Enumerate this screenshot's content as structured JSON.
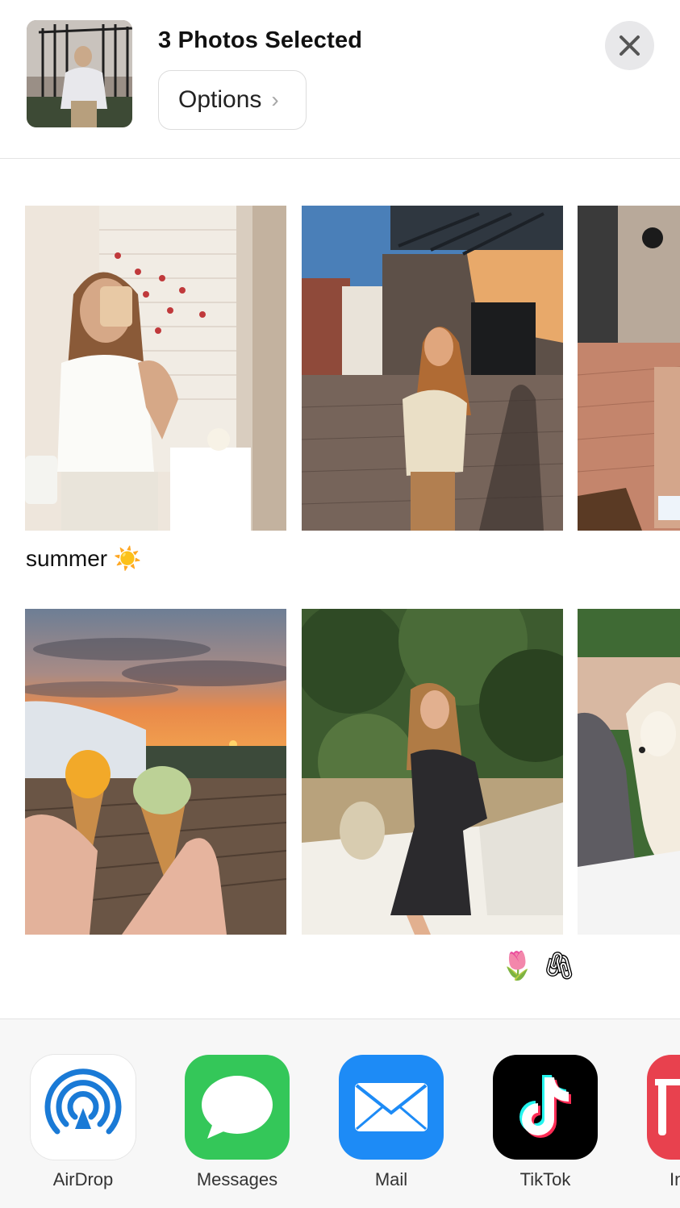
{
  "header": {
    "title": "3 Photos Selected",
    "options_label": "Options",
    "options_chevron": "›"
  },
  "gallery": {
    "posts": [
      {
        "caption": "summer ☀️"
      },
      {
        "caption": "🌷 🖇"
      }
    ]
  },
  "share_apps": [
    {
      "label": "AirDrop",
      "icon": "airdrop-icon"
    },
    {
      "label": "Messages",
      "icon": "messages-icon"
    },
    {
      "label": "Mail",
      "icon": "mail-icon"
    },
    {
      "label": "TikTok",
      "icon": "tiktok-icon"
    },
    {
      "label": "In",
      "icon": "app-icon-partial"
    }
  ],
  "colors": {
    "messages_green": "#34c759",
    "mail_blue": "#1d8bf6",
    "airdrop_blue": "#1a7ad6",
    "tiktok_black": "#000000",
    "partial_app_red": "#e8414e"
  }
}
